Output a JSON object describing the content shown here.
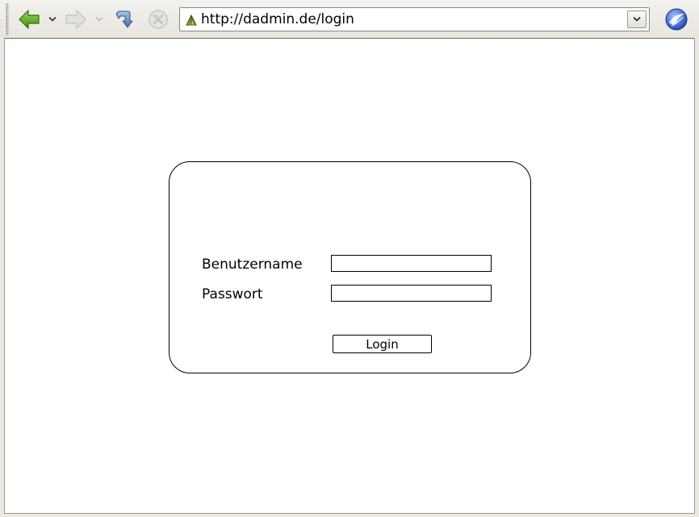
{
  "browser": {
    "url": "http://dadmin.de/login",
    "icons": {
      "back": "back-arrow-icon",
      "forward": "forward-arrow-icon",
      "reload": "reload-icon",
      "stop": "stop-icon",
      "site": "site-favicon-icon",
      "url_dropdown": "chevron-down-icon",
      "throbber": "browser-logo-icon"
    },
    "colors": {
      "back_arrow": "#5aa81e",
      "disabled": "#c8c6c1",
      "reload": "#5b86b8"
    }
  },
  "login_form": {
    "username_label": "Benutzername",
    "username_value": "",
    "password_label": "Passwort",
    "password_value": "",
    "submit_label": "Login"
  }
}
